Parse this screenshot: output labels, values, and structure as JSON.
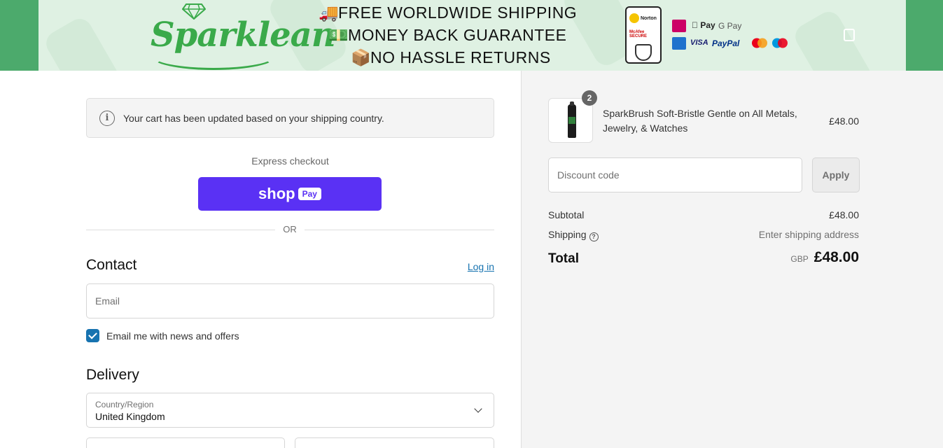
{
  "banner": {
    "logo_text": "Sparklean",
    "promos": [
      {
        "icon": "truck-icon",
        "glyph": "🚚",
        "text": "FREE WORLDWIDE SHIPPING"
      },
      {
        "icon": "money-icon",
        "glyph": "💵",
        "text": "MONEY BACK GUARANTEE"
      },
      {
        "icon": "package-icon",
        "glyph": "📦",
        "text": "NO HASSLE RETURNS"
      }
    ],
    "norton_label": "Norton",
    "mcafee_label": "McAfee SECURE",
    "payments": {
      "ideal": "iDEAL",
      "apple_pay": "Pay",
      "google_pay": "G Pay",
      "amex": "AM EX",
      "visa": "VISA",
      "paypal": "PayPal"
    }
  },
  "notice": {
    "text": "Your cart has been updated based on your shipping country."
  },
  "express": {
    "label": "Express checkout",
    "shop_label": "shop",
    "pay_label": "Pay",
    "or": "OR"
  },
  "contact": {
    "heading": "Contact",
    "login": "Log in",
    "email_placeholder": "Email",
    "news_label": "Email me with news and offers"
  },
  "delivery": {
    "heading": "Delivery",
    "country_label": "Country/Region",
    "country_value": "United Kingdom"
  },
  "summary": {
    "qty": "2",
    "product_name": "SparkBrush Soft-Bristle Gentle on All Metals, Jewelry, & Watches",
    "product_price": "£48.00",
    "discount_placeholder": "Discount code",
    "apply": "Apply",
    "subtotal_label": "Subtotal",
    "subtotal_value": "£48.00",
    "shipping_label": "Shipping",
    "shipping_value": "Enter shipping address",
    "total_label": "Total",
    "currency": "GBP",
    "total_value": "£48.00"
  },
  "colors": {
    "accent": "#5a31f4",
    "link": "#1773b0",
    "brand_green": "#3aaa4a"
  }
}
